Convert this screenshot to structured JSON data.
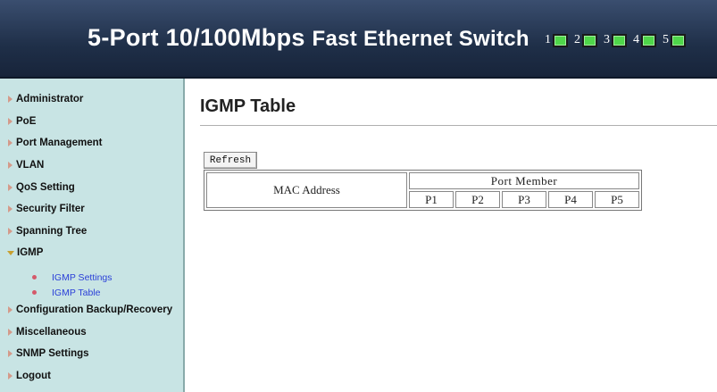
{
  "header": {
    "title_prefix": "5-Port 10/100Mbps",
    "title_suffix": "Fast Ethernet Switch",
    "ports": [
      "1",
      "2",
      "3",
      "4",
      "5"
    ]
  },
  "sidebar": {
    "items": [
      {
        "label": "Administrator"
      },
      {
        "label": "PoE"
      },
      {
        "label": "Port Management"
      },
      {
        "label": "VLAN"
      },
      {
        "label": "QoS Setting"
      },
      {
        "label": "Security Filter"
      },
      {
        "label": "Spanning Tree"
      },
      {
        "label": "IGMP"
      },
      {
        "label": "Configuration Backup/Recovery"
      },
      {
        "label": "Miscellaneous"
      },
      {
        "label": "SNMP Settings"
      },
      {
        "label": "Logout"
      }
    ],
    "igmp_sub": [
      {
        "label": "IGMP Settings"
      },
      {
        "label": "IGMP Table"
      }
    ]
  },
  "main": {
    "title": "IGMP Table",
    "refresh_label": "Refresh",
    "table": {
      "mac_header": "MAC Address",
      "port_member_header": "Port Member",
      "ports": [
        "P1",
        "P2",
        "P3",
        "P4",
        "P5"
      ]
    }
  },
  "colors": {
    "header_bg": "#1f2f48",
    "sidebar_bg": "#c8e4e4",
    "link_color": "#2a3fd8",
    "led_green": "#4fd64a"
  }
}
